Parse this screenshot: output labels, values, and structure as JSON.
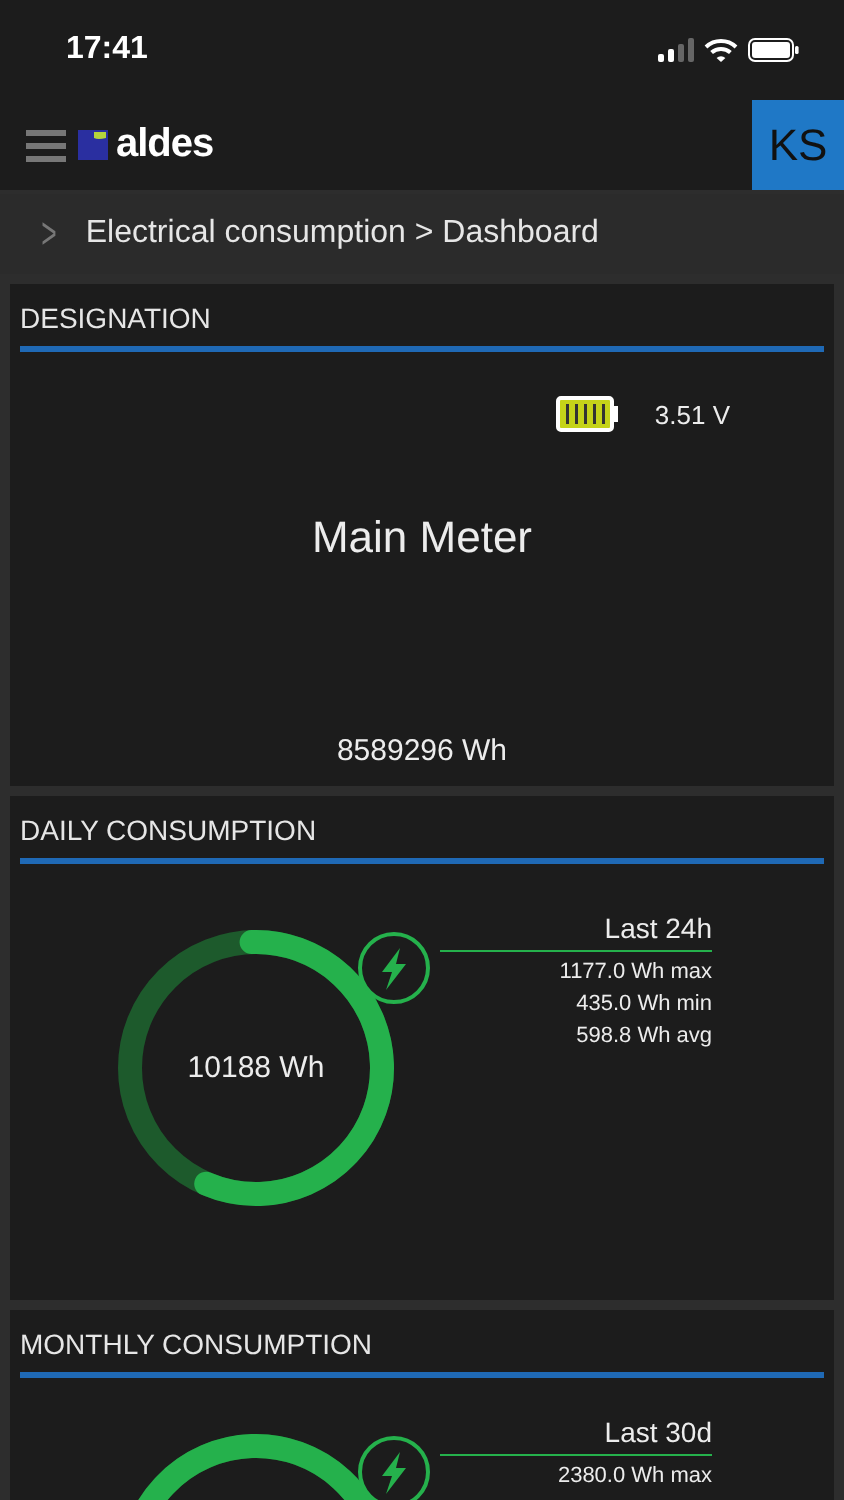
{
  "status_bar": {
    "time": "17:41"
  },
  "header": {
    "logo": "aldes",
    "avatar": "KS"
  },
  "breadcrumb": {
    "icon": ">",
    "path": "Electrical consumption > Dashboard"
  },
  "designation": {
    "title": "DESIGNATION",
    "voltage": "3.51 V",
    "name": "Main Meter",
    "total": "8589296 Wh"
  },
  "consumption": [
    {
      "title": "DAILY CONSUMPTION",
      "total": "10188 Wh",
      "period": "Last 24h",
      "level": 0.57,
      "stats": [
        "1177.0 Wh max",
        "435.0 Wh min",
        "598.8 Wh avg"
      ]
    },
    {
      "title": "MONTHLY CONSUMPTION",
      "period": "Last 30d",
      "stats": [
        "2380.0 Wh max"
      ]
    }
  ]
}
